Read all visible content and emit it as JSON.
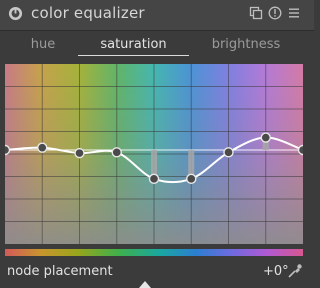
{
  "module": {
    "title": "color equalizer",
    "icons": [
      "power-icon",
      "presets-icon",
      "reset-icon",
      "menu-icon"
    ]
  },
  "tabs": [
    {
      "label": "hue",
      "active": false
    },
    {
      "label": "saturation",
      "active": true
    },
    {
      "label": "brightness",
      "active": false
    }
  ],
  "curve": {
    "node_levels": [
      0.0,
      0.03,
      -0.04,
      -0.03,
      -0.37,
      -0.37,
      -0.03,
      0.16,
      0.0
    ],
    "line_color": "#ffffff",
    "node_color": "#4a4a4a"
  },
  "footer": {
    "label": "node placement",
    "value": "+0°",
    "picker_icon": "color-picker-icon"
  }
}
